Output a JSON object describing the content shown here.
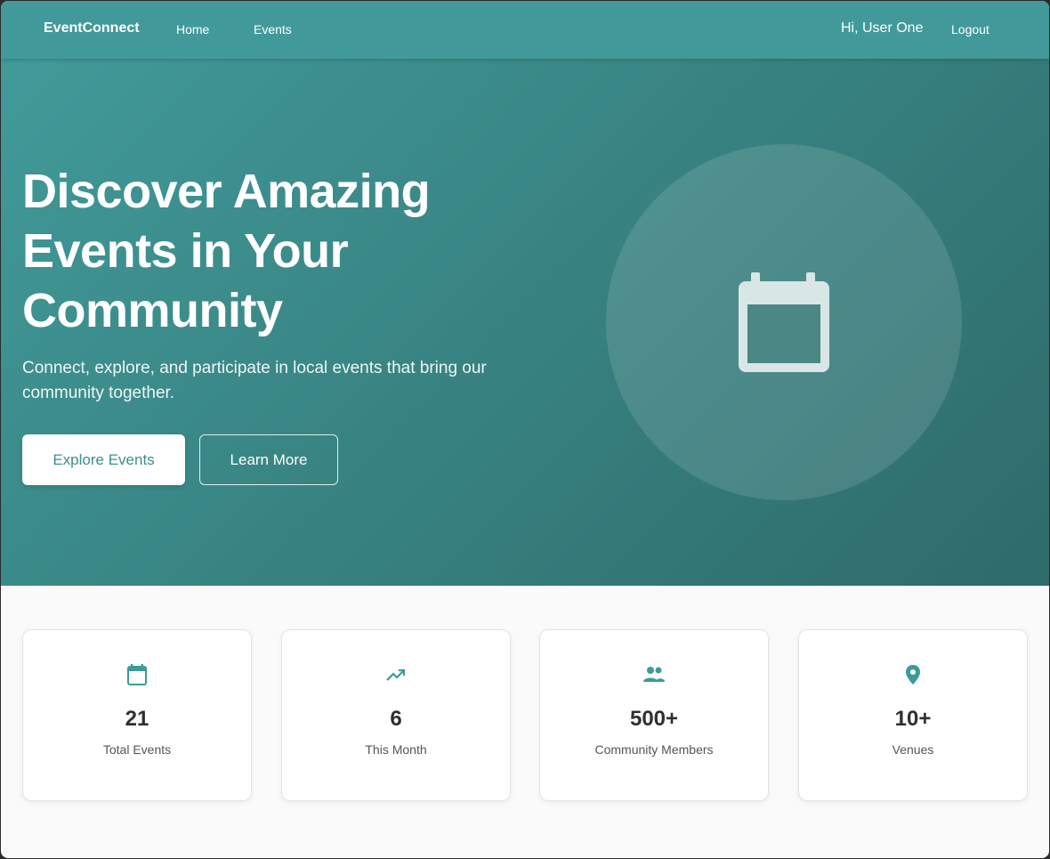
{
  "nav": {
    "brand": "EventConnect",
    "home": "Home",
    "events": "Events",
    "greeting": "Hi, User One",
    "logout": "Logout"
  },
  "hero": {
    "title": "Discover Amazing Events in Your Community",
    "subtitle": "Connect, explore, and participate in local events that bring our community together.",
    "primary_button": "Explore Events",
    "secondary_button": "Learn More",
    "illustration_icon": "calendar-icon"
  },
  "stats": [
    {
      "icon": "calendar-icon",
      "value": "21",
      "label": "Total Events"
    },
    {
      "icon": "trending-up-icon",
      "value": "6",
      "label": "This Month"
    },
    {
      "icon": "people-icon",
      "value": "500+",
      "label": "Community Members"
    },
    {
      "icon": "location-pin-icon",
      "value": "10+",
      "label": "Venues"
    }
  ],
  "colors": {
    "brand_teal": "#419a99",
    "hero_dark": "#2e6b6a",
    "page_bg": "#fafafa",
    "icon_teal": "#3d9a98"
  }
}
